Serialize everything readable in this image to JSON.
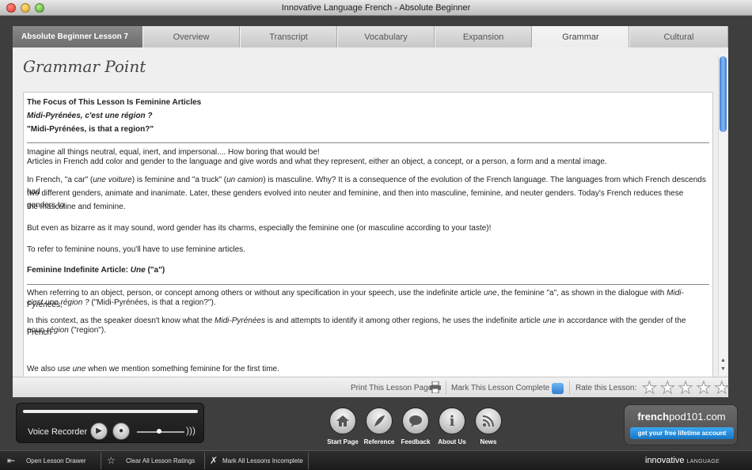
{
  "window": {
    "title": "Innovative Language French - Absolute Beginner"
  },
  "tabs": {
    "lesson_label": "Absolute Beginner Lesson 7",
    "items": [
      {
        "label": "Overview"
      },
      {
        "label": "Transcript"
      },
      {
        "label": "Vocabulary"
      },
      {
        "label": "Expansion"
      },
      {
        "label": "Grammar",
        "active": true
      },
      {
        "label": "Cultural"
      }
    ]
  },
  "main": {
    "title": "Grammar Point",
    "heading": "The Focus of This Lesson Is Feminine Articles",
    "french_sentence": "Midi-Pyrénées, c'est une région ?",
    "english_sentence": "\"Midi-Pyrénées, is that a region?\"",
    "p1_line1": "Imagine all things neutral, equal, inert, and impersonal.... How boring that would be!",
    "p1_line2": "Articles in French add color and gender to the language and give words and what they represent, either an object, a concept, or a person, a form and a mental image.",
    "p2_part1": "In French, \"a car\" (",
    "p2_it1": "une voiture",
    "p2_part2": ") is feminine and \"a truck\" (",
    "p2_it2": "un camion",
    "p2_part3": ") is masculine. Why? It is a consequence of the evolution of the French language. The languages from which French descends had",
    "p2_line2": "two different genders, animate and inanimate. Later, these genders evolved into neuter and feminine, and then into masculine, feminine, and neuter genders. Today's French reduces these genders to",
    "p2_line3": "the masculine and feminine.",
    "p3": "But even as bizarre as it may sound, word gender has its charms, especially the feminine one (or masculine according to your taste)!",
    "p4": "To refer to feminine nouns, you'll have to use feminine articles.",
    "subheading_prefix": "Feminine Indefinite Article: ",
    "subheading_italic": "Une",
    "subheading_suffix": " (\"a\")",
    "p5_part1": "When referring to an object, person, or concept among others or without any specification in your speech, use the indefinite article ",
    "p5_it1": "une",
    "p5_part2": ", the feminine \"a\", as shown in the dialogue with ",
    "p5_it2": "Midi-Pyrénées,",
    "p5_it3": "c'est une région ?",
    "p5_part3": " (\"Midi-Pyrénées, is that a region?\").",
    "p6_part1": "In this context, as the speaker doesn't know what the ",
    "p6_it1": "Midi-Pyrénées",
    "p6_part2": " is and attempts to identify it among other regions, he uses the indefinite article ",
    "p6_it2": "une",
    "p6_part3": " in accordance with the gender of the French",
    "p6_part4": "noun ",
    "p6_it3": "région",
    "p6_part5": " (\"region\").",
    "p7_part1": "We also use ",
    "p7_it1": "une",
    "p7_part2": " when we mention something feminine for the first time."
  },
  "panel_footer": {
    "print_label": "Print This Lesson Page",
    "complete_label": "Mark This Lesson Complete",
    "rate_label": "Rate this Lesson:",
    "rating": 0,
    "max_rating": 5
  },
  "recorder": {
    "label": "Voice Recorder",
    "volume_level": 0.47
  },
  "nav_buttons": [
    {
      "label": "Start Page",
      "icon": "home-icon"
    },
    {
      "label": "Reference",
      "icon": "feather-icon"
    },
    {
      "label": "Feedback",
      "icon": "speech-bubble-icon"
    },
    {
      "label": "About Us",
      "icon": "info-icon"
    },
    {
      "label": "News",
      "icon": "rss-icon"
    }
  ],
  "brand": {
    "name_bold": "french",
    "name_rest": "pod101.com",
    "cta": "get your free lifetime account"
  },
  "bottombar": {
    "drawer": "Open Lesson Drawer",
    "clear_ratings": "Clear All Lesson Ratings",
    "mark_incomplete": "Mark All Lessons Incomplete",
    "logo_main": "innovative",
    "logo_small": "LANGUAGE"
  },
  "colors": {
    "heading_red": "#d41c1c",
    "navy": "#1a1a7a",
    "accent_blue": "#2f7fcf"
  }
}
